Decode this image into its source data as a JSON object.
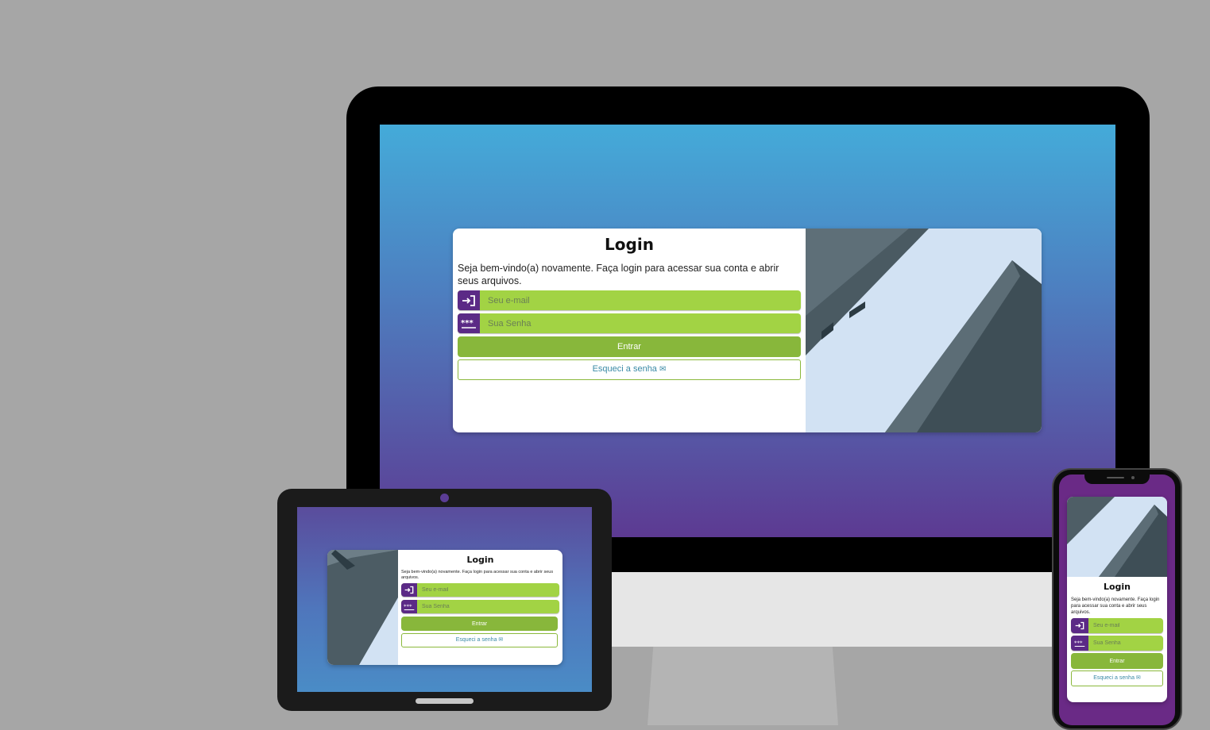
{
  "login": {
    "title": "Login",
    "welcome": "Seja bem-vindo(a) novamente. Faça login para acessar sua conta e abrir seus arquivos.",
    "email_placeholder": "Seu e-mail",
    "password_placeholder": "Sua Senha",
    "enter_label": "Entrar",
    "forgot_label": "Esqueci a senha",
    "forgot_icon": "envelope-icon",
    "email_icon": "login-arrow-icon",
    "password_icon": "password-dots-icon"
  },
  "colors": {
    "brand_purple": "#5b2a86",
    "input_green": "#a2d344",
    "button_green": "#88b73b",
    "link_teal": "#3a8aa6",
    "bg_gradient_top": "#44abd9",
    "bg_gradient_bottom": "#5d3a92"
  }
}
